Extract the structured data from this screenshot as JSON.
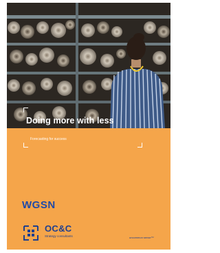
{
  "cover": {
    "title": "Doing more with less",
    "subtitle": "Forecasting for success",
    "brand": "WGSN",
    "partner_name": "OC&C",
    "partner_tagline": "Strategy consultants",
    "footer_tagline": "uncommon sense™"
  },
  "colors": {
    "background": "#f5a54a",
    "brand_blue": "#1f4aa8",
    "partner_blue": "#1f3f8f",
    "photo_dark": "#2c2722"
  }
}
